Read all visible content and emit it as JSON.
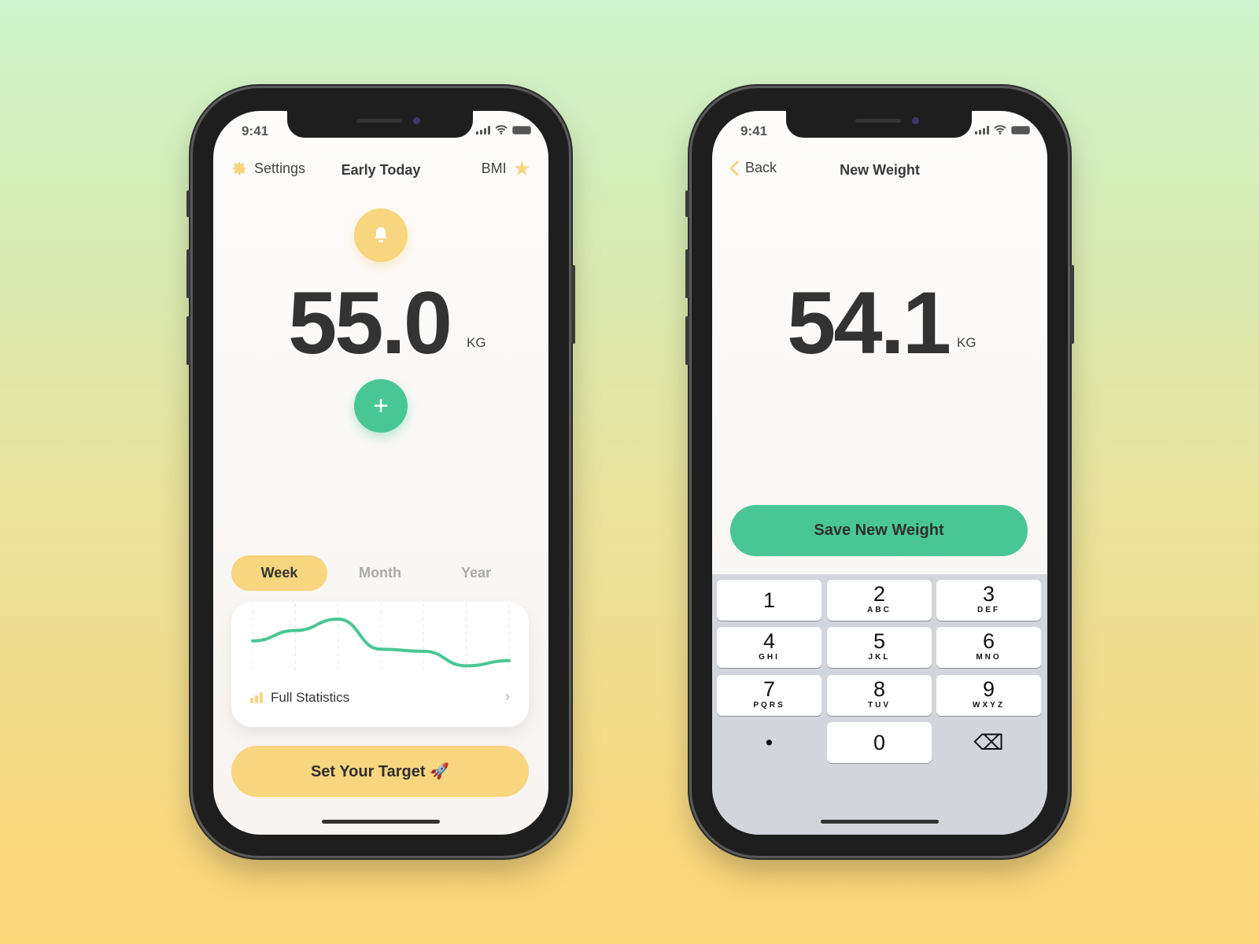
{
  "colors": {
    "accent_yellow": "#f8d57f",
    "accent_green": "#48c794",
    "text_dark": "#333333"
  },
  "left_phone": {
    "status": {
      "time": "9:41"
    },
    "nav": {
      "settings_label": "Settings",
      "settings_icon": "gear-icon",
      "title": "Early Today",
      "bmi_label": "BMI",
      "bmi_icon": "star-icon"
    },
    "reminder_icon": "bell-icon",
    "weight": {
      "value": "55.0",
      "unit": "KG"
    },
    "add_icon": "plus-icon",
    "tabs": [
      {
        "label": "Week",
        "active": true
      },
      {
        "label": "Month",
        "active": false
      },
      {
        "label": "Year",
        "active": false
      }
    ],
    "card": {
      "label": "Full Statistics",
      "icon": "bar-chart-icon",
      "chevron": "›"
    },
    "target_button": "Set Your Target 🚀"
  },
  "chart_data": {
    "type": "line",
    "values": [
      58,
      78,
      100,
      42,
      38,
      10,
      20
    ],
    "grid": "vertical-dashed",
    "color": "#48c794"
  },
  "right_phone": {
    "status": {
      "time": "9:41"
    },
    "nav": {
      "back_label": "Back",
      "title": "New Weight"
    },
    "weight": {
      "value": "54.1",
      "unit": "KG"
    },
    "save_button": "Save New Weight",
    "keypad": [
      {
        "n": "1",
        "l": ""
      },
      {
        "n": "2",
        "l": "ABC"
      },
      {
        "n": "3",
        "l": "DEF"
      },
      {
        "n": "4",
        "l": "GHI"
      },
      {
        "n": "5",
        "l": "JKL"
      },
      {
        "n": "6",
        "l": "MNO"
      },
      {
        "n": "7",
        "l": "PQRS"
      },
      {
        "n": "8",
        "l": "TUV"
      },
      {
        "n": "9",
        "l": "WXYZ"
      },
      {
        "n": "•",
        "l": ""
      },
      {
        "n": "0",
        "l": ""
      },
      {
        "n": "⌫",
        "l": ""
      }
    ]
  }
}
